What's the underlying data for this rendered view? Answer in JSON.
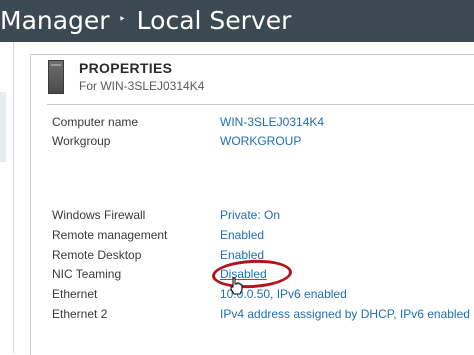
{
  "header": {
    "breadcrumb_parent": "Manager",
    "breadcrumb_separator": "‣",
    "breadcrumb_current": "Local Server"
  },
  "properties": {
    "title": "PROPERTIES",
    "subtitle": "For WIN-3SLEJ0314K4",
    "rows": [
      {
        "label": "Computer name",
        "value": "WIN-3SLEJ0314K4"
      },
      {
        "label": "Workgroup",
        "value": "WORKGROUP"
      },
      {
        "label": "Windows Firewall",
        "value": "Private: On"
      },
      {
        "label": "Remote management",
        "value": "Enabled"
      },
      {
        "label": "Remote Desktop",
        "value": "Enabled"
      },
      {
        "label": "NIC Teaming",
        "value": "Disabled"
      },
      {
        "label": "Ethernet",
        "value": "10.0.0.50, IPv6 enabled"
      },
      {
        "label": "Ethernet 2",
        "value": "IPv4 address assigned by DHCP, IPv6 enabled"
      }
    ]
  },
  "colors": {
    "link": "#1f6db5",
    "annotation_circle": "#b3151c",
    "titlebar": "#3b4a52"
  },
  "icons": {
    "server": "server-icon",
    "cursor": "hand-cursor-icon"
  }
}
